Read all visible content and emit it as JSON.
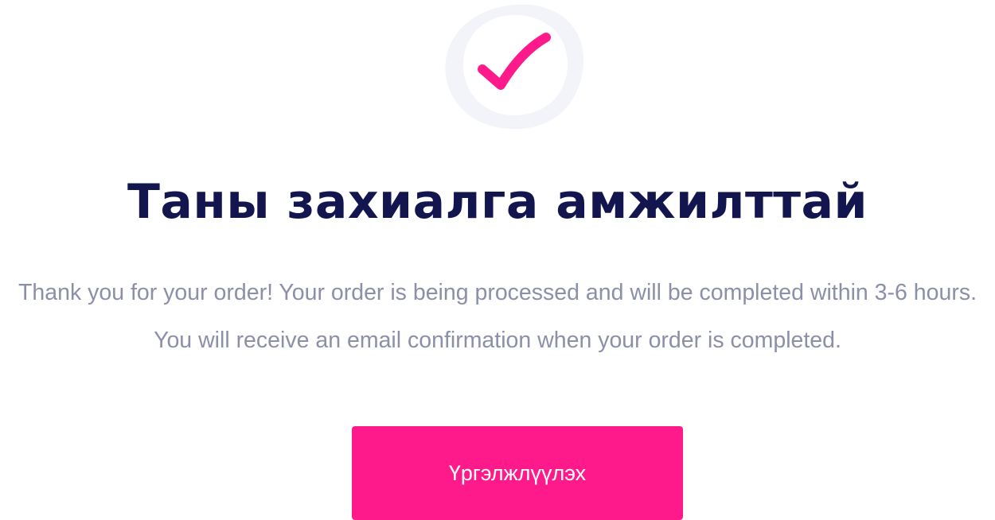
{
  "icon": "check-icon",
  "title": "Таны захиалга амжилттай",
  "message": "Thank you for your order! Your order is being processed and will be completed within 3-6 hours. You will receive an email confirmation when your order is completed.",
  "continue_label": "Үргэлжлүүлэх",
  "colors": {
    "accent": "#ff1a8c",
    "title": "#13164e",
    "text": "#8c8fa8",
    "icon_ring": "#f3f4f9"
  }
}
